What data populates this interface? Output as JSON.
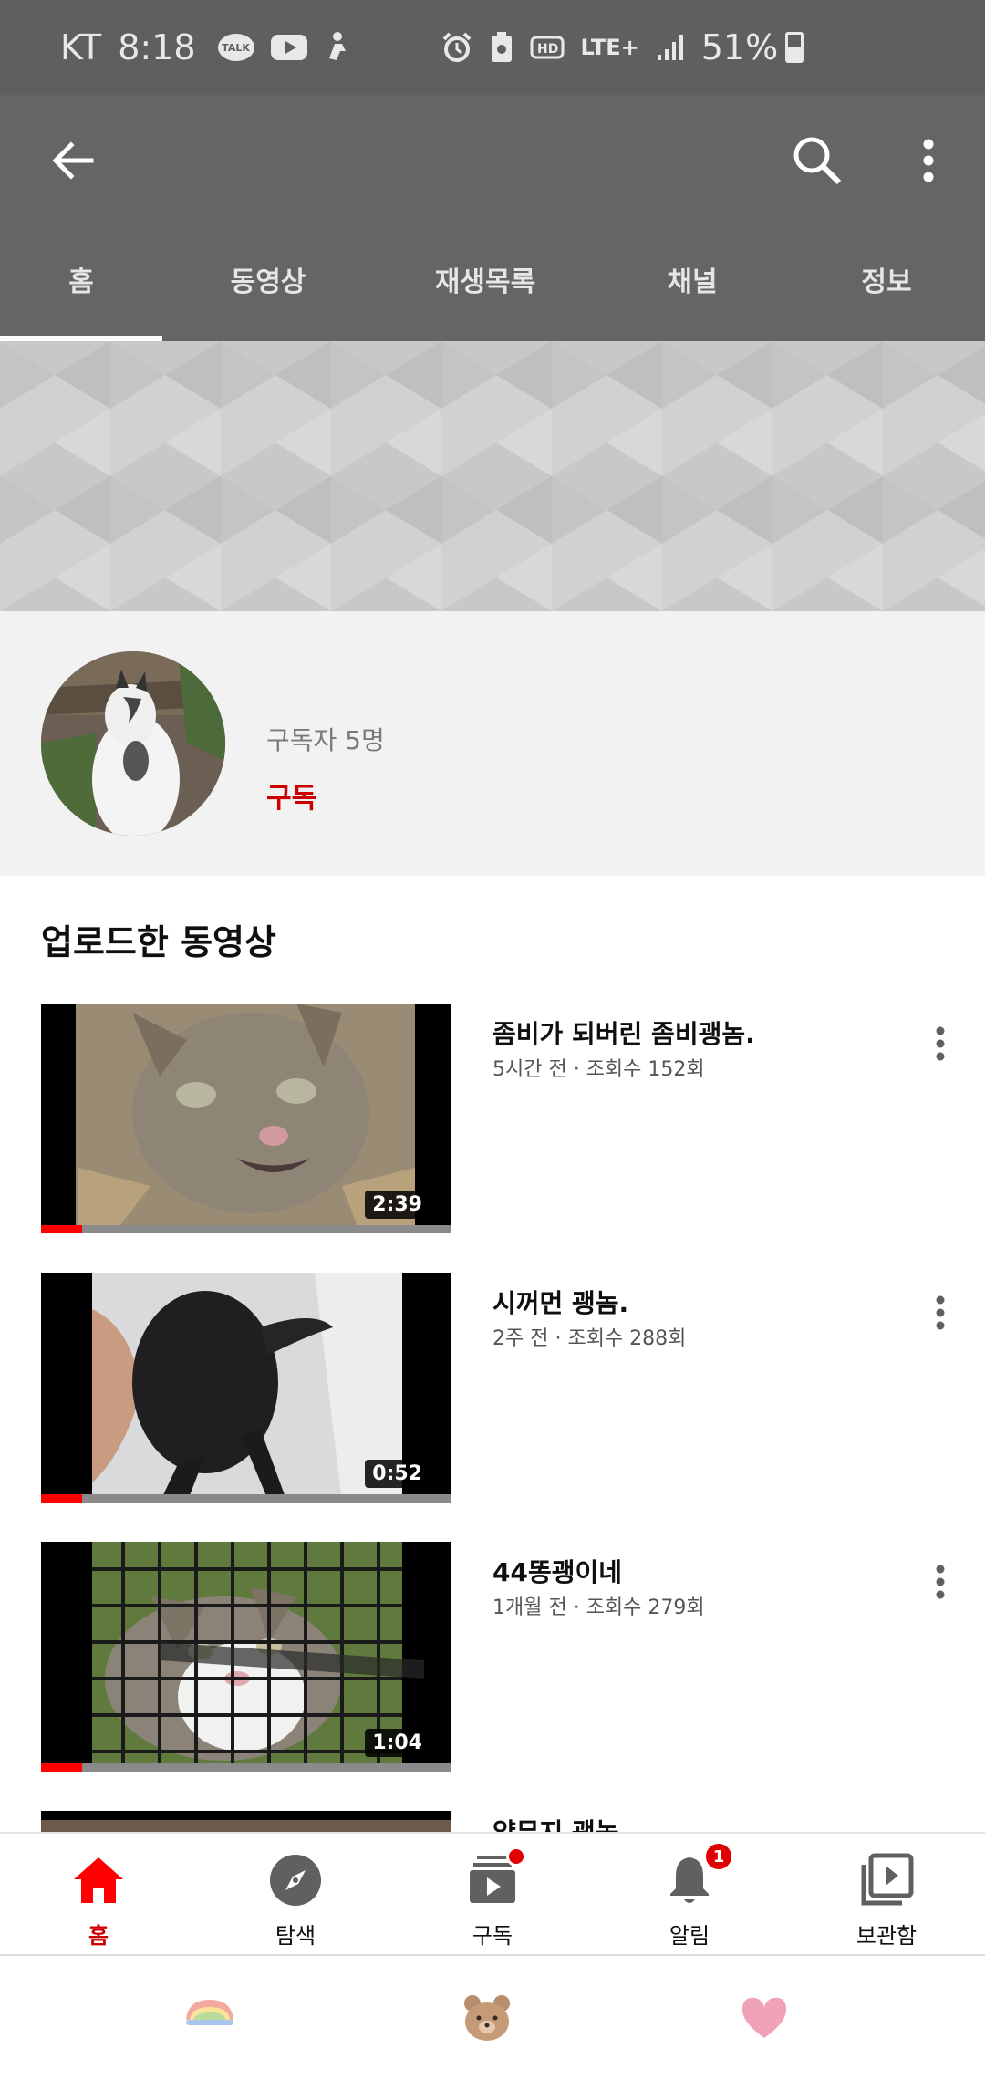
{
  "status_bar": {
    "carrier": "KT",
    "time": "8:18",
    "talk_label": "TALK",
    "network": "LTE+",
    "battery": "51%",
    "icons": [
      "kakaotalk-icon",
      "youtube-icon",
      "accessibility-icon",
      "alarm-icon",
      "battery-saver-icon",
      "hd-voice-icon",
      "lte-icon",
      "signal-icon",
      "battery-icon"
    ]
  },
  "app_bar": {
    "icons": [
      "back-arrow-icon",
      "search-icon",
      "more-vert-icon"
    ]
  },
  "tabs": [
    {
      "label": "홈",
      "active": true
    },
    {
      "label": "동영상",
      "active": false
    },
    {
      "label": "재생목록",
      "active": false
    },
    {
      "label": "채널",
      "active": false
    },
    {
      "label": "정보",
      "active": false
    }
  ],
  "channel": {
    "subscribers": "구독자 5명",
    "subscribe_label": "구독"
  },
  "section": {
    "title": "업로드한 동영상"
  },
  "videos": [
    {
      "title": "좀비가 되버린 좀비괭놈.",
      "meta": "5시간 전 · 조회수 152회",
      "duration": "2:39",
      "progress": 0.1
    },
    {
      "title": "시꺼먼 괭놈.",
      "meta": "2주 전 · 조회수 288회",
      "duration": "0:52",
      "progress": 0.1
    },
    {
      "title": "44똥괭이네",
      "meta": "1개월 전 · 조회수 279회",
      "duration": "1:04",
      "progress": 0.1
    },
    {
      "title": "얍무지 괭놈.",
      "meta": "",
      "duration": "",
      "progress": 0
    }
  ],
  "bottom_nav": [
    {
      "label": "홈",
      "icon": "home-icon",
      "active": true
    },
    {
      "label": "탐색",
      "icon": "explore-icon",
      "active": false
    },
    {
      "label": "구독",
      "icon": "subscriptions-icon",
      "active": false
    },
    {
      "label": "알림",
      "icon": "notifications-icon",
      "active": false,
      "badge": "1"
    },
    {
      "label": "보관함",
      "icon": "library-icon",
      "active": false
    }
  ],
  "colors": {
    "accent": "#cc0000",
    "progress": "#ff0000",
    "app_bar": "#656565",
    "status_bar": "#5f5f5f"
  }
}
